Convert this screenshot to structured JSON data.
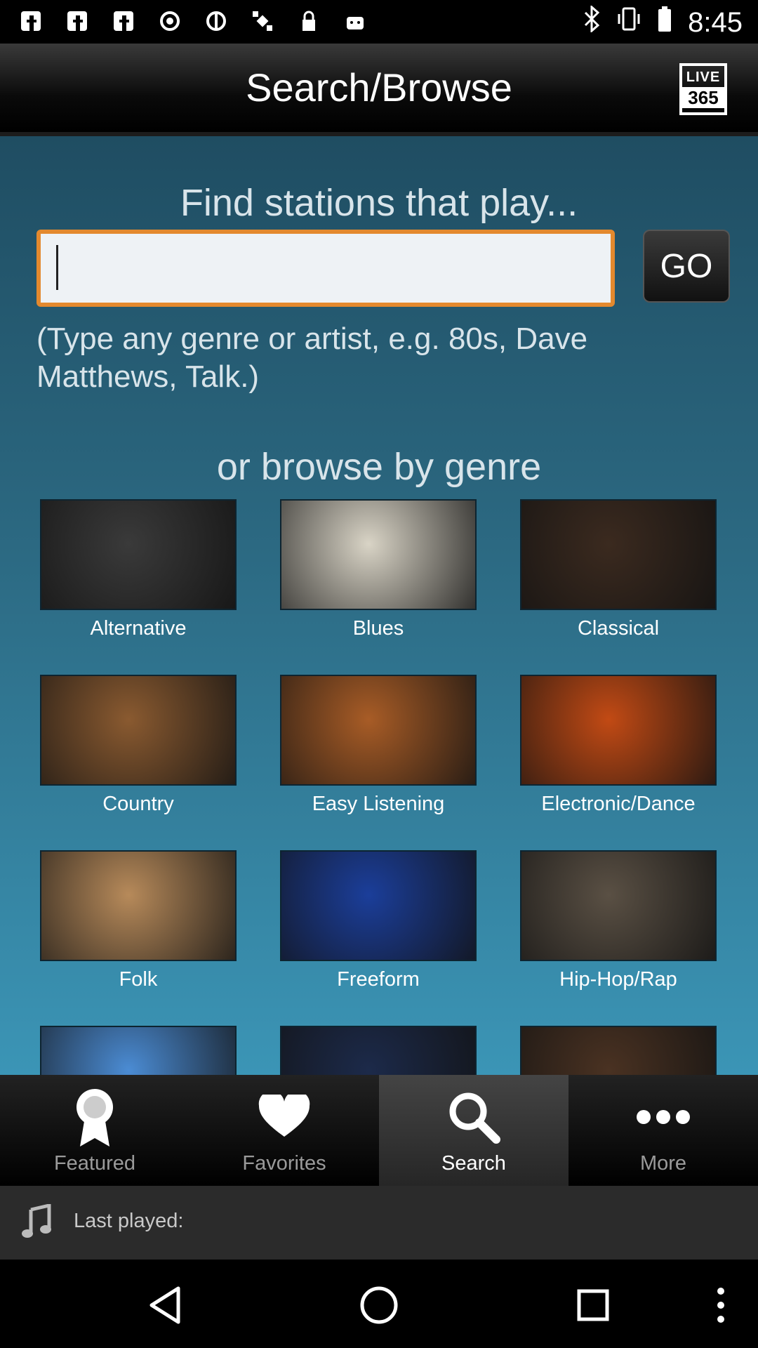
{
  "status_bar": {
    "time": "8:45",
    "left_icons": [
      "facebook-icon",
      "facebook-icon",
      "facebook-icon",
      "circle-dot-icon",
      "no-sign-icon",
      "satellite-icon",
      "lock-icon",
      "android-icon"
    ],
    "right_icons": [
      "bluetooth-icon",
      "vibrate-icon",
      "battery-icon"
    ]
  },
  "header": {
    "title": "Search/Browse",
    "logo_line1": "LIVE",
    "logo_line2": "365"
  },
  "search": {
    "heading": "Find stations that play...",
    "input_value": "",
    "go_label": "GO",
    "hint": "(Type any genre or artist, e.g. 80s, Dave Matthews, Talk.)"
  },
  "browse": {
    "heading": "or browse by genre",
    "genres": [
      {
        "label": "Alternative",
        "color": "#3a3a3a"
      },
      {
        "label": "Blues",
        "color": "#d9d4c6"
      },
      {
        "label": "Classical",
        "color": "#3b2a1f"
      },
      {
        "label": "Country",
        "color": "#8a5a30"
      },
      {
        "label": "Easy Listening",
        "color": "#a85c26"
      },
      {
        "label": "Electronic/Dance",
        "color": "#c24a14"
      },
      {
        "label": "Folk",
        "color": "#b78a5a"
      },
      {
        "label": "Freeform",
        "color": "#1b3e9a"
      },
      {
        "label": "Hip-Hop/Rap",
        "color": "#5a5044"
      },
      {
        "label": "",
        "color": "#4b8cd4"
      },
      {
        "label": "",
        "color": "#1c2a4a"
      },
      {
        "label": "",
        "color": "#4a3222"
      }
    ]
  },
  "tabs": [
    {
      "label": "Featured",
      "icon": "award-ribbon-icon"
    },
    {
      "label": "Favorites",
      "icon": "heart-icon"
    },
    {
      "label": "Search",
      "icon": "search-icon",
      "active": true
    },
    {
      "label": "More",
      "icon": "more-dots-icon"
    }
  ],
  "last_played": {
    "label": "Last played:"
  }
}
